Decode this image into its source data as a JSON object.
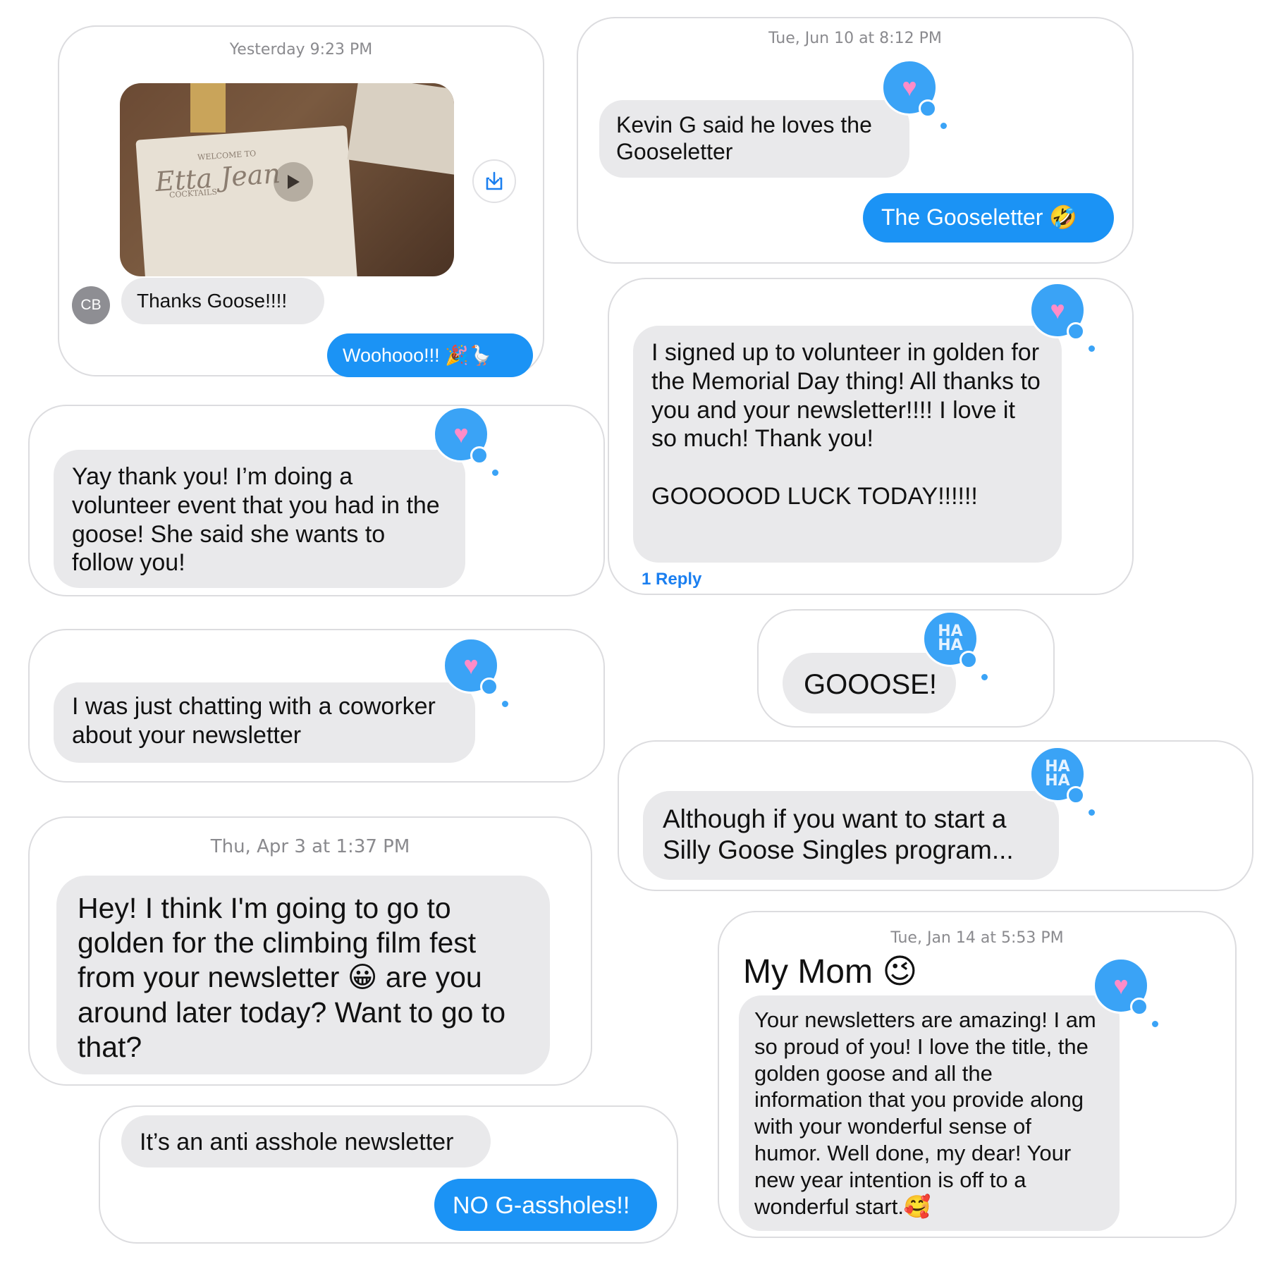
{
  "cards": {
    "video": {
      "timestamp": "Yesterday 9:23 PM",
      "video_text_1": "WELCOME TO",
      "video_text_2": "Etta Jean",
      "video_text_3": "COCKTAILS",
      "avatar_initials": "CB",
      "received": "Thanks Goose!!!!",
      "sent": "Woohooo!!! 🎉🪿"
    },
    "kevin": {
      "timestamp": "Tue, Jun 10 at 8:12 PM",
      "received": "Kevin G said he loves the Gooseletter",
      "sent": "The Gooseletter 🤣"
    },
    "volunteer": {
      "received": "Yay thank you! I’m doing a volunteer event that you had in the goose! She said she wants to follow you!"
    },
    "golden": {
      "received_p1": "I signed up to volunteer in golden for the Memorial Day thing! All thanks to you and your newsletter!!!! I love it so much! Thank you!",
      "received_p2": "GOOOOOD LUCK TODAY!!!!!!",
      "reply_link": "1 Reply"
    },
    "coworker": {
      "received": "I was just chatting with a coworker about your newsletter"
    },
    "gooose": {
      "received": "GOOOSE!",
      "tapback": "HA HA"
    },
    "singles": {
      "received": "Although if you want to start a Silly Goose Singles program...",
      "tapback": "HA HA"
    },
    "filmfest": {
      "timestamp": "Thu, Apr 3 at 1:37 PM",
      "received": "Hey! I think I'm going to go to golden for the climbing film fest from your newsletter 😀 are you around later today? Want to go to that?"
    },
    "mom": {
      "timestamp": "Tue, Jan 14 at 5:53 PM",
      "heading": "My Mom 😉",
      "received": "Your newsletters are amazing! I am so proud of you! I love the title, the golden goose and all the information that you provide along with your wonderful sense of humor. Well done, my dear! Your new year intention is off to a wonderful start.🥰"
    },
    "antiasshole": {
      "received": "It’s an anti asshole newsletter",
      "sent": "NO G-assholes!!"
    }
  },
  "icons": {
    "heart": "heart-icon",
    "haha": "haha-icon",
    "play": "play-icon",
    "download": "download-icon"
  },
  "colors": {
    "sent_bubble": "#1b93f5",
    "received_bubble": "#e9e9eb",
    "tapback": "#3aa3f6",
    "timestamp": "#8a8a8e",
    "reply_link": "#1b7ff0"
  }
}
